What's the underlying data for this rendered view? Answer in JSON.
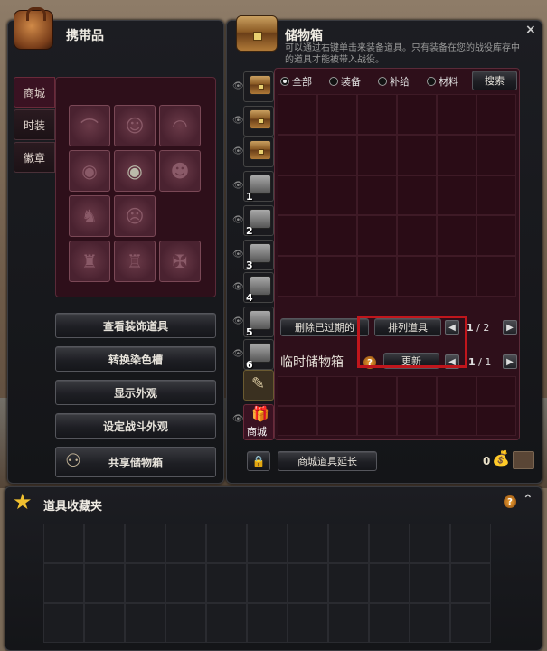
{
  "inventory": {
    "title": "携带品",
    "tabs": [
      "商城",
      "时装",
      "徽章"
    ],
    "buttons": {
      "view": "查看装饰道具",
      "dye": "转换染色槽",
      "show": "显示外观",
      "battle": "设定战斗外观",
      "share": "共享储物箱"
    }
  },
  "storage": {
    "title": "储物箱",
    "close": "×",
    "desc": "可以通过右键单击来装备道具。只有装备在您的战役库存中的道具才能被带入战役。",
    "filters": [
      "全部",
      "装备",
      "补给",
      "材料"
    ],
    "selected_filter": "全部",
    "search": "搜索",
    "side_tabs": [
      "",
      "",
      "",
      "1",
      "2",
      "3",
      "4",
      "5",
      "6",
      "",
      ""
    ],
    "shop_tab": "商城",
    "delete_expired": "删除已过期的",
    "sort": "排列道具",
    "page": "1",
    "total": "2",
    "temp_title": "临时储物箱",
    "refresh": "更新",
    "temp_page": "1",
    "temp_total": "1",
    "extend": "商城道具延长",
    "gold": "0"
  },
  "favorites": {
    "title": "道具收藏夹",
    "collapse": "⌃"
  },
  "colors": {
    "highlight": "#c0161c",
    "maroon": "#2e0f1a"
  }
}
